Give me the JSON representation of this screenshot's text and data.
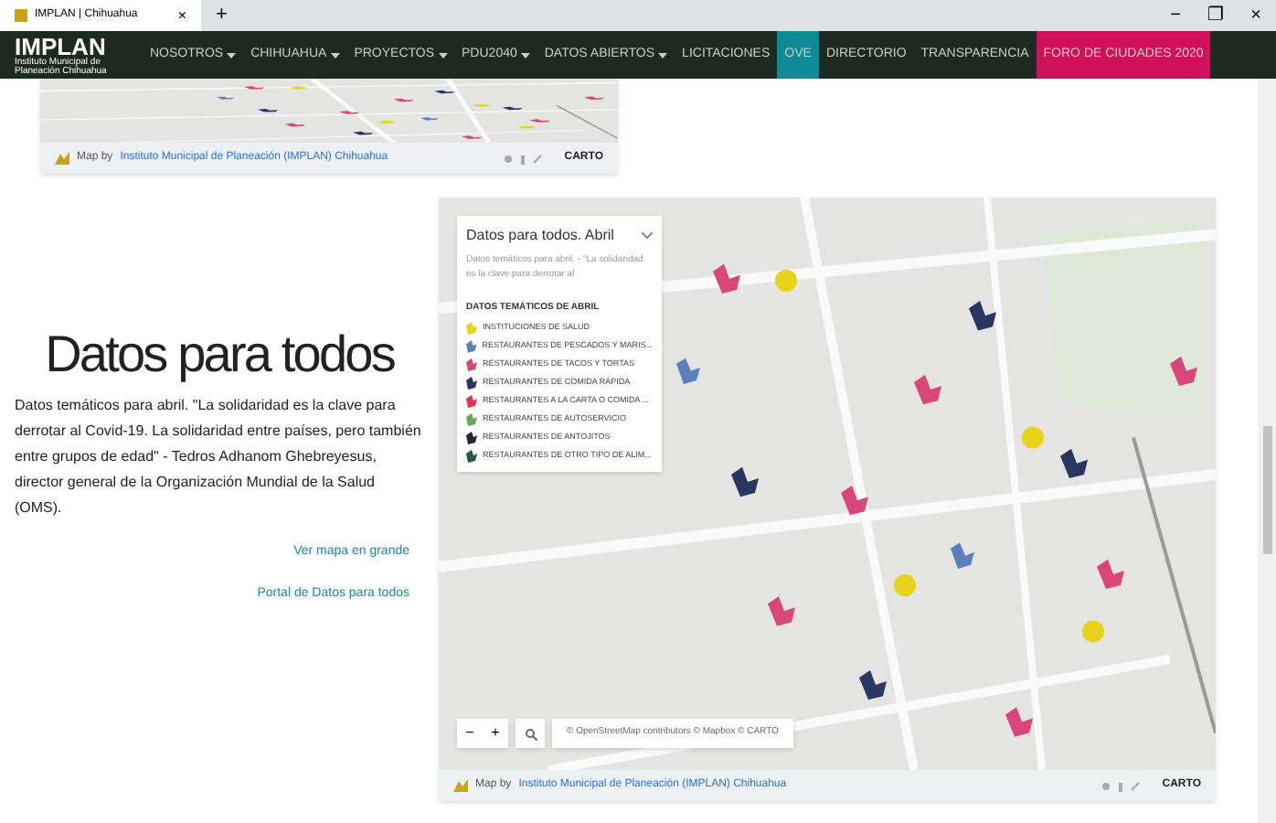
{
  "browser": {
    "tab_title": "IMPLAN | Chihuahua",
    "close": "×",
    "new_tab": "+",
    "window_buttons": [
      "−",
      "❐",
      "×"
    ]
  },
  "nav": {
    "logo": "IMPLAN",
    "logo_sub": "Instituto Municipal de Planeación Chihuahua",
    "items": [
      {
        "label": "NOSOTROS",
        "has_menu": true
      },
      {
        "label": "CHIHUAHUA",
        "has_menu": true
      },
      {
        "label": "PROYECTOS",
        "has_menu": true
      },
      {
        "label": "PDU2040",
        "has_menu": true
      },
      {
        "label": "DATOS ABIERTOS",
        "has_menu": true
      },
      {
        "label": "LICITACIONES",
        "has_menu": false
      },
      {
        "label": "OVE",
        "has_menu": false,
        "color": "#0e8a96"
      },
      {
        "label": "DIRECTORIO",
        "has_menu": false
      },
      {
        "label": "TRANSPARENCIA",
        "has_menu": false
      },
      {
        "label": "FORO DE CIUDADES 2020",
        "has_menu": false,
        "color": "#d0105a"
      }
    ]
  },
  "top_map": {
    "credit_prefix": "Map by",
    "credit_link": "Instituto Municipal de Planeación (IMPLAN) Chihuahua",
    "brand": "CARTO"
  },
  "section": {
    "title": "Datos para todos",
    "body": "Datos temáticos para abril. \"La solidaridad es la clave para derrotar al Covid-19. La solidaridad entre países, pero también entre grupos de edad\" - Tedros Adhanom Ghebreyesus, director general de la Organización Mundial de la Salud (OMS).",
    "links": [
      "Ver mapa en grande",
      "Portal de Datos para todos"
    ]
  },
  "map": {
    "legend": {
      "title": "Datos para todos. Abril",
      "description": "Datos temáticos para abril. - \"La solidaridad es la clave para derrotar al",
      "heading": "DATOS TEMÁTICOS DE ABRIL",
      "items": [
        {
          "label": "INSTITUCIONES DE SALUD",
          "color": "#e8d21a"
        },
        {
          "label": "RESTAURANTES DE PESCADOS Y MARIS...",
          "color": "#5b7fb8"
        },
        {
          "label": "RESTAURANTES DE TACOS Y TORTAS",
          "color": "#d9467a"
        },
        {
          "label": "RESTAURANTES DE COMIDA RÁPIDA",
          "color": "#2a3560"
        },
        {
          "label": "RESTAURANTES A LA CARTA O COMIDA ...",
          "color": "#e0325a"
        },
        {
          "label": "RESTAURANTES DE AUTOSERVICIO",
          "color": "#6aa84f"
        },
        {
          "label": "RESTAURANTES DE ANTOJITOS",
          "color": "#2b2233"
        },
        {
          "label": "RESTAURANTES DE OTRO TIPO DE ALIM...",
          "color": "#1f5a4a"
        }
      ]
    },
    "zoom_out": "−",
    "zoom_in": "+",
    "attribution": "© OpenStreetMap contributors © Mapbox © CARTO",
    "credit_prefix": "Map by",
    "credit_link": "Instituto Municipal de Planeación (IMPLAN) Chihuahua",
    "brand": "CARTO"
  }
}
